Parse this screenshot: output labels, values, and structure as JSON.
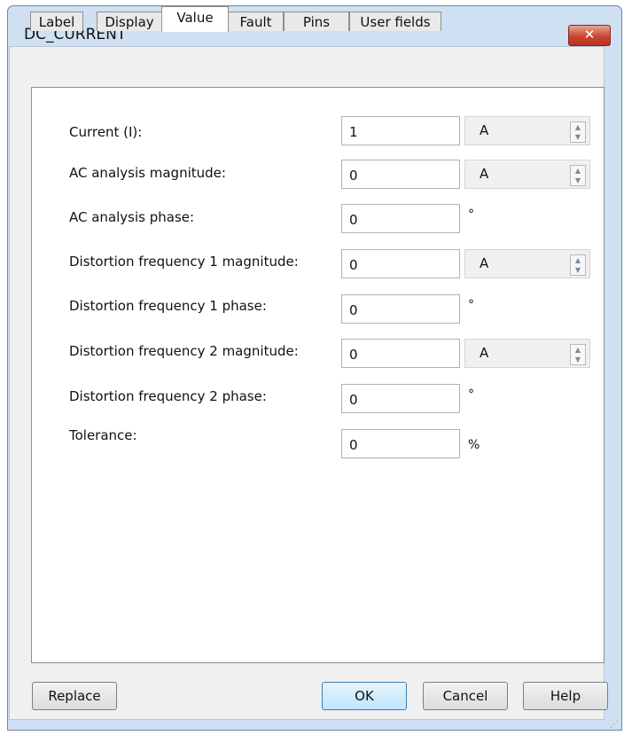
{
  "window": {
    "title": "DC_CURRENT",
    "close_glyph": "✕"
  },
  "tabs": [
    {
      "label": "Label"
    },
    {
      "label": "Display"
    },
    {
      "label": "Value",
      "active": true
    },
    {
      "label": "Fault"
    },
    {
      "label": "Pins"
    },
    {
      "label": "User fields"
    }
  ],
  "fields": [
    {
      "label": "Current (I):",
      "value": "1",
      "unit": "A",
      "spinner": true
    },
    {
      "label": "AC analysis magnitude:",
      "value": "0",
      "unit": "A",
      "spinner": true
    },
    {
      "label": "AC analysis phase:",
      "value": "0",
      "unit": "°",
      "spinner": false
    },
    {
      "label": "Distortion frequency 1 magnitude:",
      "value": "0",
      "unit": "A",
      "spinner": true
    },
    {
      "label": "Distortion frequency 1 phase:",
      "value": "0",
      "unit": "°",
      "spinner": false
    },
    {
      "label": "Distortion frequency 2 magnitude:",
      "value": "0",
      "unit": "A",
      "spinner": true
    },
    {
      "label": "Distortion frequency 2 phase:",
      "value": "0",
      "unit": "°",
      "spinner": false
    },
    {
      "label": "Tolerance:",
      "value": "0",
      "unit": "%",
      "spinner": false
    }
  ],
  "buttons": {
    "replace": "Replace",
    "ok": "OK",
    "cancel": "Cancel",
    "help": "Help"
  }
}
